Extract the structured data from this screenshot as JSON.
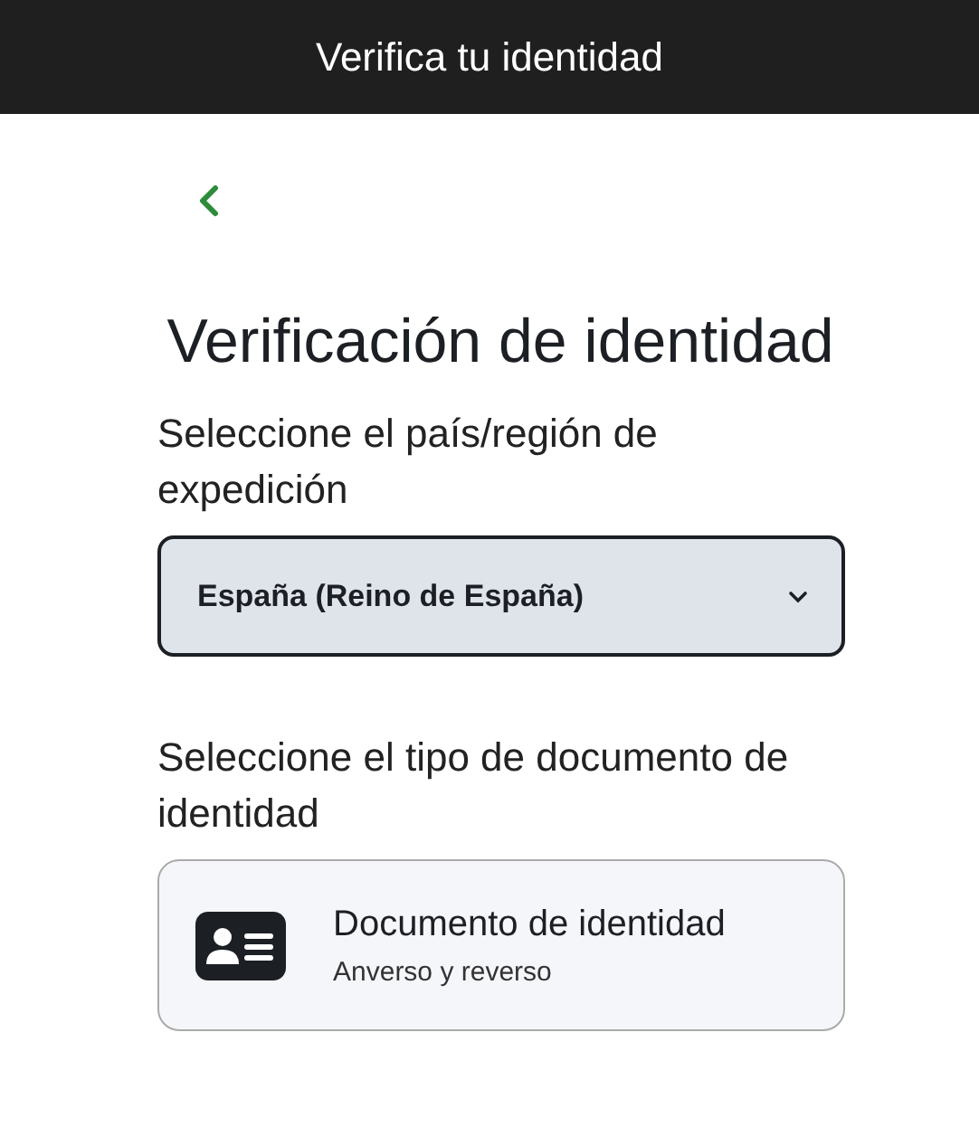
{
  "header": {
    "title": "Verifica tu identidad"
  },
  "heading": "Verificación de identidad",
  "country": {
    "label": "Seleccione el país/región de expedición",
    "value": "España (Reino de España)"
  },
  "document": {
    "label": "Seleccione el tipo de documento de identidad",
    "options": [
      {
        "title": "Documento de identidad",
        "subtitle": "Anverso y reverso"
      }
    ]
  }
}
